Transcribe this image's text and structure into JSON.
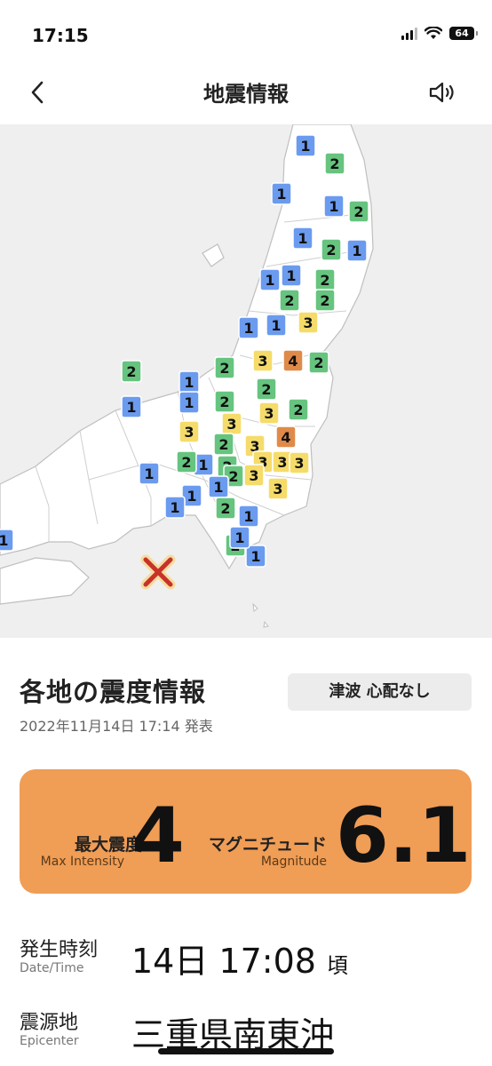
{
  "status_bar": {
    "time": "17:15",
    "battery": "64",
    "icons": [
      "cellular-signal-icon",
      "wifi-icon",
      "battery-icon"
    ]
  },
  "nav": {
    "title": "地震情報",
    "back_icon": "chevron-left-icon",
    "sound_icon": "speaker-icon"
  },
  "map": {
    "epicenter_icon": "epicenter-x-icon",
    "markers": [
      "1",
      "2",
      "1",
      "1",
      "2",
      "1",
      "2",
      "1",
      "1",
      "1",
      "2",
      "2",
      "2",
      "1",
      "1",
      "3",
      "2",
      "2",
      "3",
      "4",
      "2",
      "1",
      "1",
      "2",
      "2",
      "1",
      "3",
      "3",
      "2",
      "3",
      "4",
      "1",
      "2",
      "2",
      "3",
      "3",
      "1",
      "2",
      "3",
      "3",
      "3",
      "3",
      "3",
      "1",
      "1",
      "1",
      "2",
      "1",
      "2",
      "1",
      "1",
      "1",
      "2",
      "1"
    ]
  },
  "colors": {
    "intensity_1": "#6b9bef",
    "intensity_2": "#66c47f",
    "intensity_3": "#f5dc6a",
    "intensity_4": "#e08a4a",
    "summary_card": "#f09d55",
    "epicenter": "#c83228"
  },
  "panel": {
    "title": "各地の震度情報",
    "tsunami": "津波 心配なし",
    "announced": "2022年11月14日 17:14 発表"
  },
  "summary": {
    "max_intensity_label": "最大震度",
    "max_intensity_sub": "Max Intensity",
    "max_intensity_value": "4",
    "magnitude_label": "マグニチュード",
    "magnitude_sub": "Magnitude",
    "magnitude_value": "6.1"
  },
  "details": {
    "datetime_label": "発生時刻",
    "datetime_sub": "Date/Time",
    "datetime_value": "14日 17:08",
    "datetime_suffix": "頃",
    "epicenter_label": "震源地",
    "epicenter_sub": "Epicenter",
    "epicenter_value": "三重県南東沖"
  }
}
